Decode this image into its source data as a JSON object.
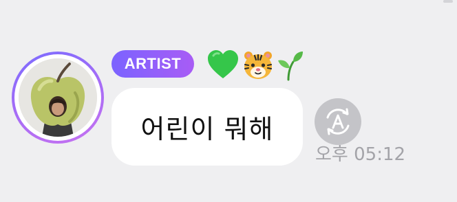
{
  "message": {
    "badge_label": "ARTIST",
    "badge_colors": [
      "#7b63ff",
      "#a85cf5"
    ],
    "reaction_icons": [
      "green-heart-icon",
      "tiger-face-icon",
      "seedling-icon"
    ],
    "text": "어린이 뭐해",
    "timestamp": "오후 05:12",
    "translate_icon": "translate-a-icon",
    "avatar": "artist-avatar-green-apple-costume",
    "avatar_ring_color": "#a26cf7"
  }
}
